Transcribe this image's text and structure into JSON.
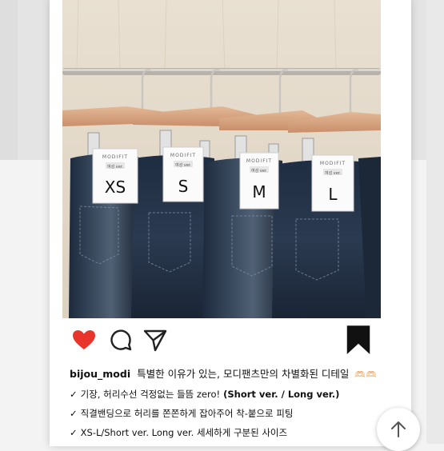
{
  "post": {
    "username": "bijou_modi",
    "caption": "특별한 이유가 있는, 모디팬츠만의 차별화된 디테일",
    "caption_emoji": "🫶🏻🫶🏻",
    "bullets": [
      {
        "check": "✓",
        "text": "기장, 허리수선 걱정없는 들뜸 zero!",
        "bold": " (Short ver. / Long ver.)"
      },
      {
        "check": "✓",
        "text": "직결밴딩으로 허리를 쫀쫀하게 잡아주어 착-붙으로 피팅",
        "bold": ""
      },
      {
        "check": "✓",
        "text": "XS-L/Short ver. Long ver. 세세하게 구분된 사이즈",
        "bold": ""
      }
    ]
  },
  "photo": {
    "tags": [
      {
        "brand": "MODIFIT",
        "variant": "여성 ver.",
        "size": "XS"
      },
      {
        "brand": "MODIFIT",
        "variant": "여성 ver.",
        "size": "S"
      },
      {
        "brand": "MODIFIT",
        "variant": "여성 ver.",
        "size": "M"
      },
      {
        "brand": "MODIFIT",
        "variant": "여성 ver.",
        "size": "L"
      }
    ]
  },
  "icons": {
    "like": "heart-icon",
    "comment": "comment-icon",
    "share": "send-icon",
    "save": "bookmark-icon",
    "scroll": "arrow-up-icon"
  },
  "colors": {
    "like": "#e8342a",
    "denim": "#243247",
    "wall": "#e7dccc",
    "hanger": "#d7a37f"
  }
}
